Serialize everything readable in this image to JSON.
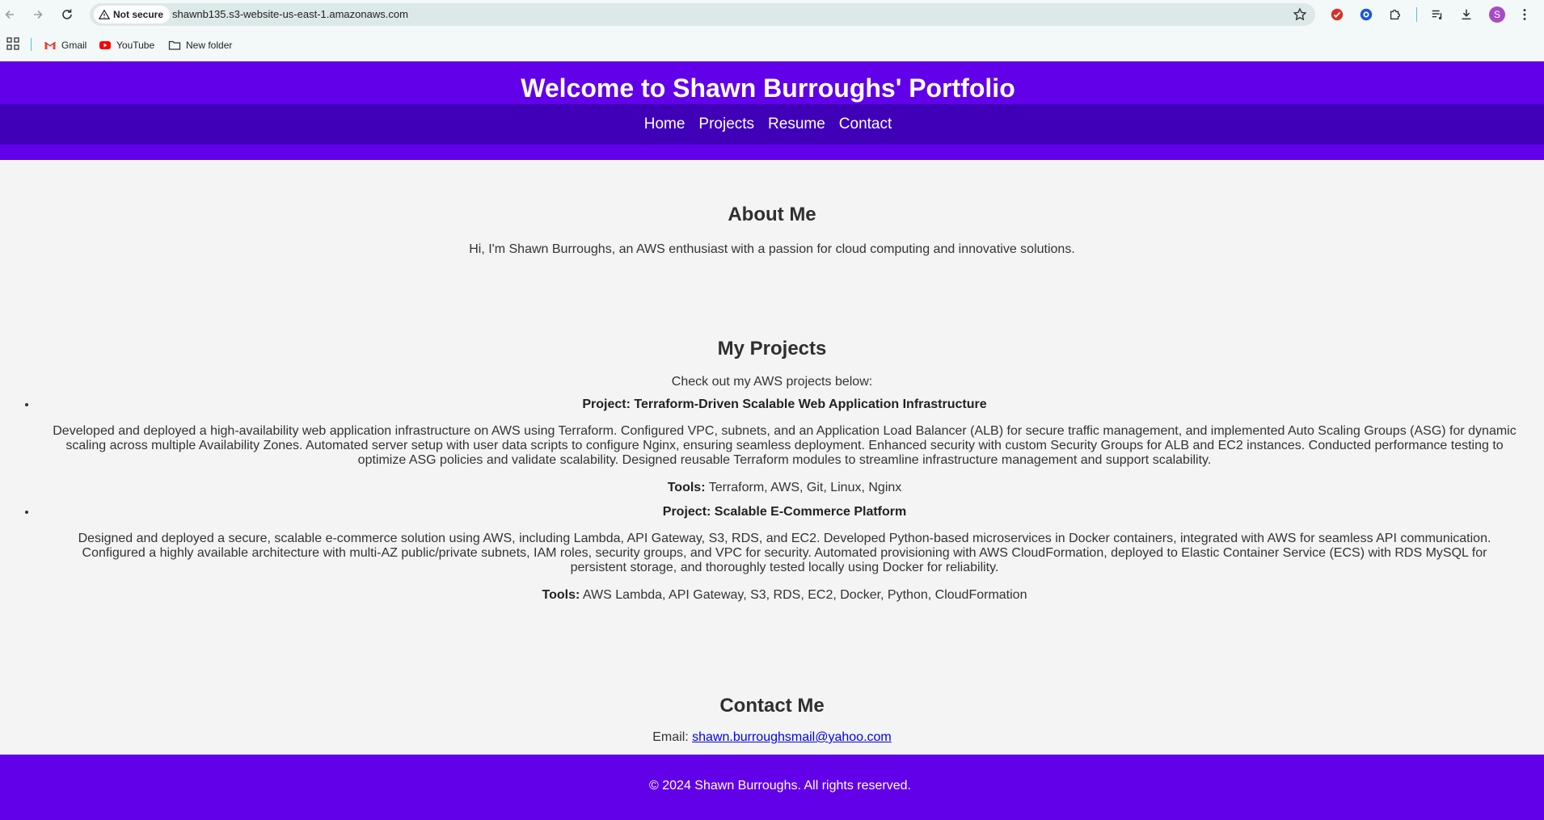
{
  "browser": {
    "security_label": "Not secure",
    "url": "shawnb135.s3-website-us-east-1.amazonaws.com",
    "profile_initial": "S",
    "bookmarks": [
      {
        "label": "Gmail",
        "icon": "gmail-icon"
      },
      {
        "label": "YouTube",
        "icon": "youtube-icon"
      },
      {
        "label": "New folder",
        "icon": "folder-icon"
      }
    ]
  },
  "header": {
    "title": "Welcome to Shawn Burroughs' Portfolio",
    "nav": [
      "Home",
      "Projects",
      "Resume",
      "Contact"
    ]
  },
  "about": {
    "heading": "About Me",
    "text": "Hi, I'm Shawn Burroughs, an AWS enthusiast with a passion for cloud computing and innovative solutions."
  },
  "projects": {
    "heading": "My Projects",
    "intro": "Check out my AWS projects below:",
    "tools_label": "Tools:",
    "items": [
      {
        "title": "Project: Terraform-Driven Scalable Web Application Infrastructure",
        "description": "Developed and deployed a high-availability web application infrastructure on AWS using Terraform. Configured VPC, subnets, and an Application Load Balancer (ALB) for secure traffic management, and implemented Auto Scaling Groups (ASG) for dynamic scaling across multiple Availability Zones. Automated server setup with user data scripts to configure Nginx, ensuring seamless deployment. Enhanced security with custom Security Groups for ALB and EC2 instances. Conducted performance testing to optimize ASG policies and validate scalability. Designed reusable Terraform modules to streamline infrastructure management and support scalability.",
        "tools": "Terraform, AWS, Git, Linux, Nginx"
      },
      {
        "title": "Project: Scalable E-Commerce Platform",
        "description": "Designed and deployed a secure, scalable e-commerce solution using AWS, including Lambda, API Gateway, S3, RDS, and EC2. Developed Python-based microservices in Docker containers, integrated with AWS for seamless API communication. Configured a highly available architecture with multi-AZ public/private subnets, IAM roles, security groups, and VPC for security. Automated provisioning with AWS CloudFormation, deployed to Elastic Container Service (ECS) with RDS MySQL for persistent storage, and thoroughly tested locally using Docker for reliability.",
        "tools": "AWS Lambda, API Gateway, S3, RDS, EC2, Docker, Python, CloudFormation"
      }
    ]
  },
  "contact": {
    "heading": "Contact Me",
    "email_label": "Email:",
    "email": "shawn.burroughsmail@yahoo.com"
  },
  "footer": {
    "text": "© 2024 Shawn Burroughs. All rights reserved."
  },
  "colors": {
    "header_bg": "#6200ea",
    "nav_bg": "#3f00b8",
    "page_bg": "#f4f4f4",
    "link": "#0000ee"
  }
}
